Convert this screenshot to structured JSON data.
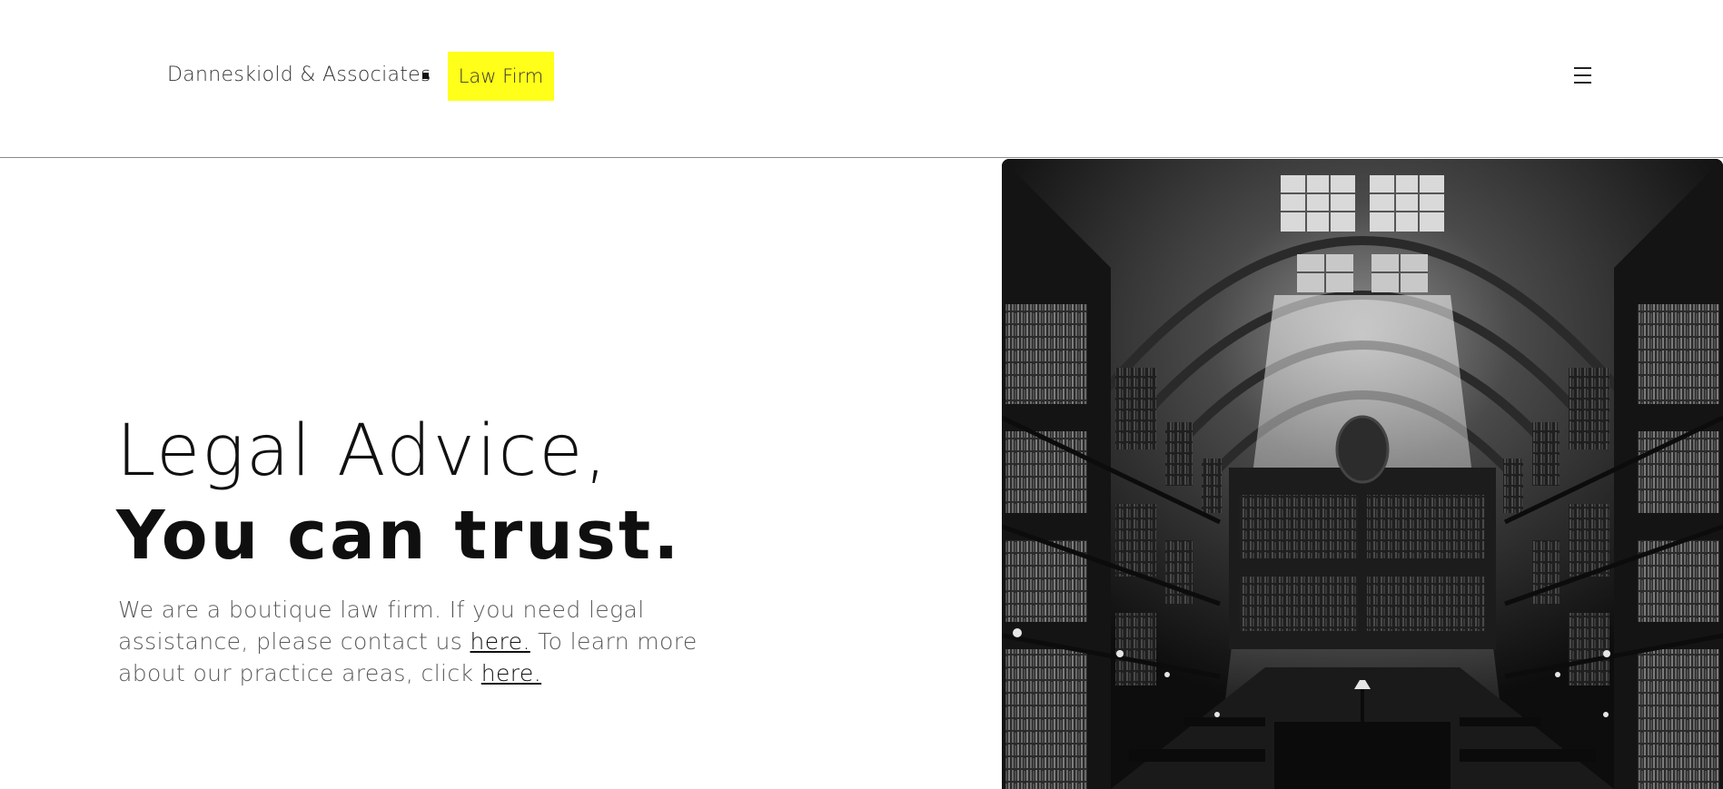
{
  "header": {
    "brand_name": "Danneskiold & Associates",
    "brand_tag": "Law Firm",
    "brand_tag_color": "#ffff1a",
    "menu_icon": "hamburger-menu-icon"
  },
  "hero": {
    "title_line1": "Legal Advice,",
    "title_line2": "You can trust.",
    "text_part1": "We are a boutique law firm. If you need legal assistance, please contact us ",
    "link1": "here.",
    "text_part2": " To learn more about our practice areas, click ",
    "link2": "here."
  },
  "image": {
    "subject": "grand library interior in black and white"
  }
}
